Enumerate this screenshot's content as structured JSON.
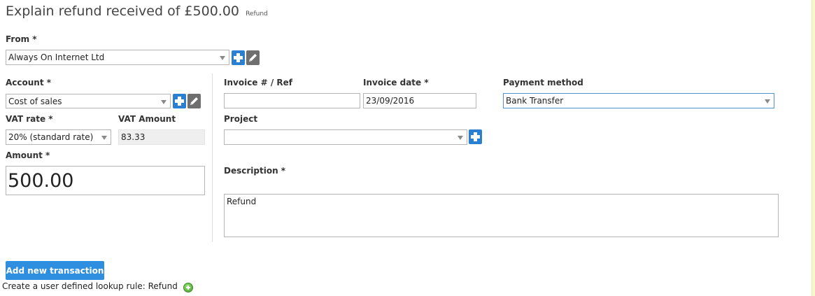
{
  "header": {
    "title": "Explain refund received of £500.00",
    "subtitle": "Refund"
  },
  "from": {
    "label": "From *",
    "value": "Always On Internet Ltd"
  },
  "account": {
    "label": "Account *",
    "value": "Cost of sales"
  },
  "vat_rate": {
    "label": "VAT rate *",
    "value": "20% (standard rate)"
  },
  "vat_amount": {
    "label": "VAT Amount",
    "value": "83.33"
  },
  "amount": {
    "label": "Amount *",
    "value": "500.00"
  },
  "invoice_ref": {
    "label": "Invoice # / Ref",
    "value": ""
  },
  "invoice_date": {
    "label": "Invoice date *",
    "value": "23/09/2016"
  },
  "payment_method": {
    "label": "Payment method",
    "value": "Bank Transfer"
  },
  "project": {
    "label": "Project",
    "value": ""
  },
  "description": {
    "label": "Description *",
    "value": "Refund"
  },
  "actions": {
    "add_transaction": "Add new transaction"
  },
  "lookup_rule": {
    "text": "Create a user defined lookup rule:  Refund"
  },
  "colors": {
    "primary": "#2e8fe0",
    "plus_button": "#2a7fd1",
    "edit_button": "#6f6f6f",
    "add_green": "#3f9d2a"
  },
  "icons": {
    "add": "plus-icon",
    "edit": "pencil-icon",
    "add_rule": "green-plus-circle-icon",
    "dropdown": "chevron-down-icon"
  }
}
